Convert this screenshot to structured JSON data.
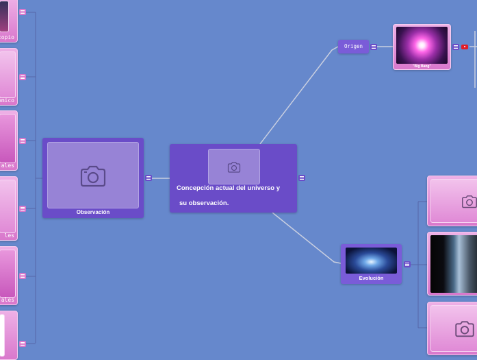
{
  "central": {
    "title_line1": "Concepción actual del universo y",
    "title_line2": "su observación."
  },
  "observacion": {
    "label": "Observación"
  },
  "origen": {
    "label": "Origen"
  },
  "big_bang": {
    "label": "\"Big Bang\""
  },
  "evolucion": {
    "label": "Evolución"
  },
  "left_items": [
    {
      "label": "copio"
    },
    {
      "label": "ómico"
    },
    {
      "label": "ales"
    },
    {
      "label": "les"
    },
    {
      "label": "ales"
    },
    {
      "label": ""
    }
  ],
  "colors": {
    "background": "#6688cc",
    "purple": "#6a4cc8",
    "pink": "#d978cc",
    "link": "#c0c8d8"
  },
  "icons": {
    "photo": "camera-icon",
    "menu": "menu-icon",
    "video": "youtube-icon"
  }
}
